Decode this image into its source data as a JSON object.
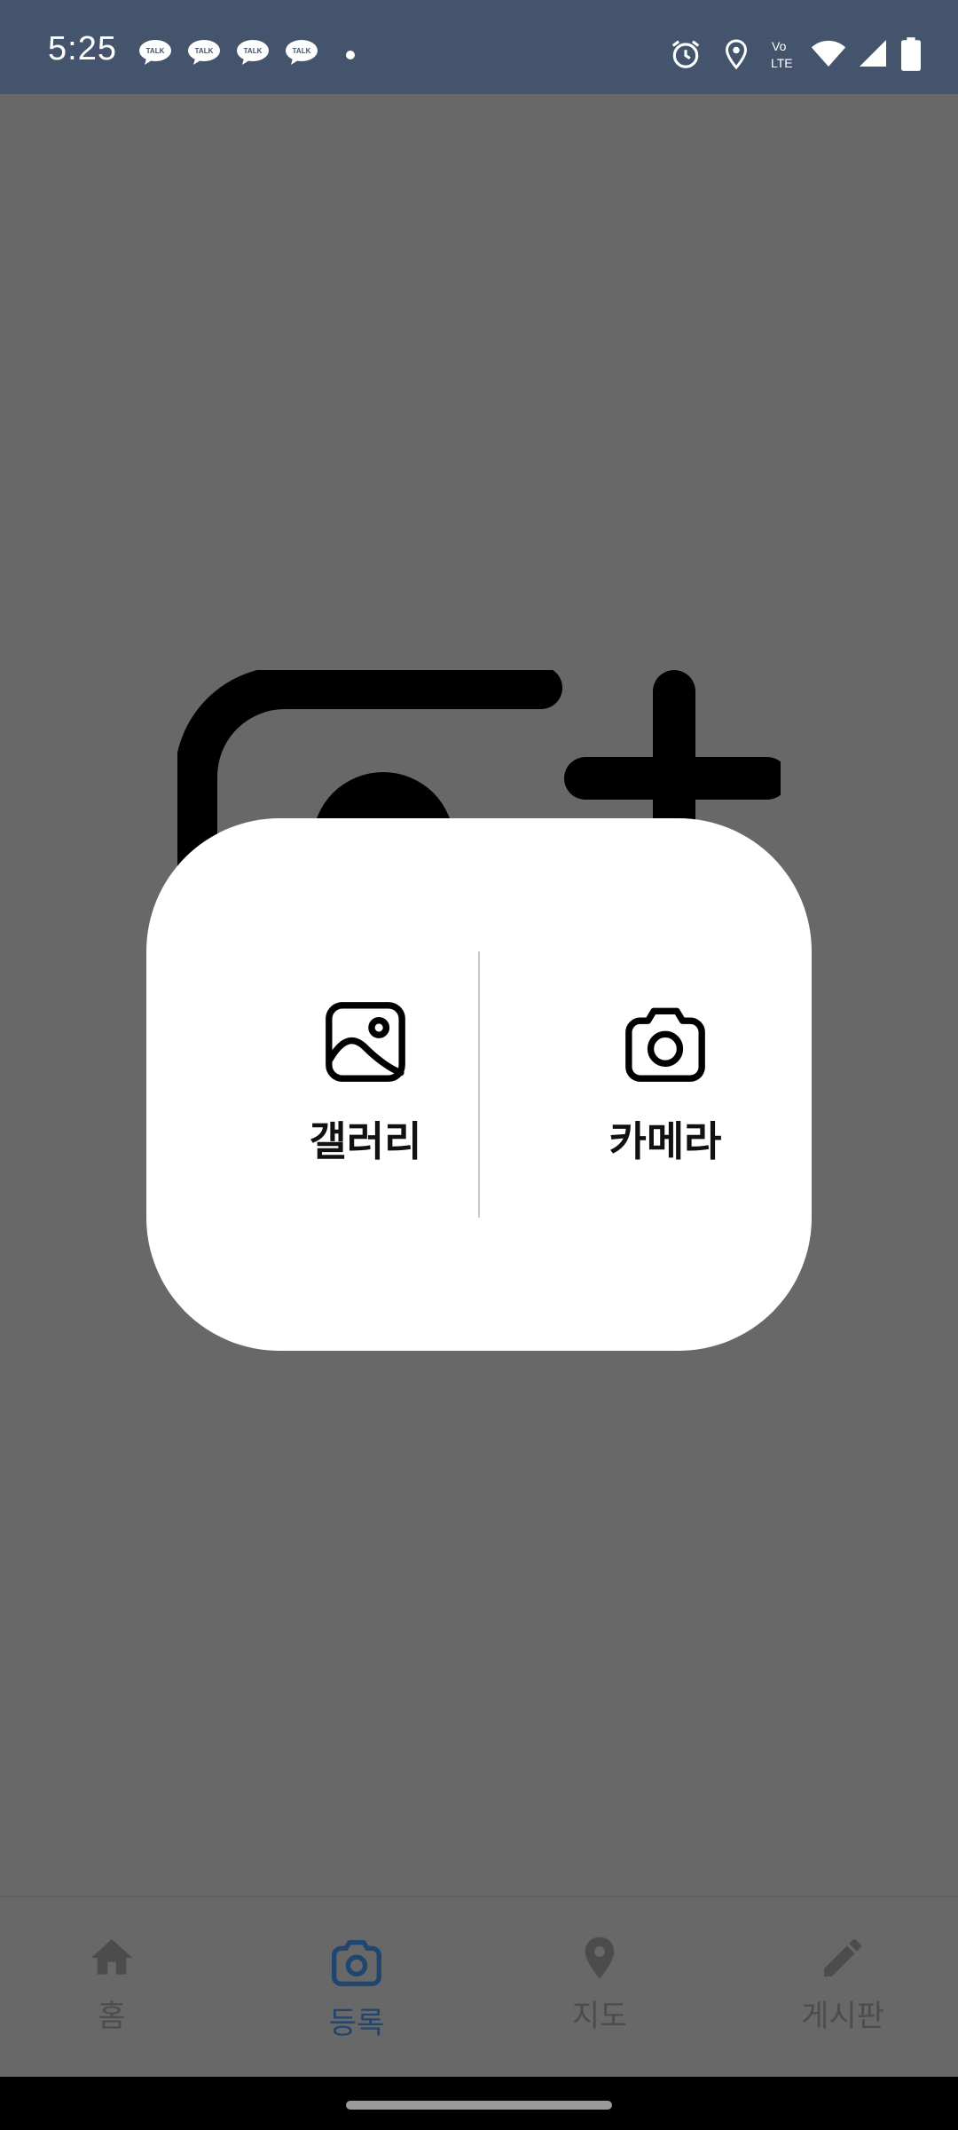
{
  "status_bar": {
    "time": "5:25",
    "notification_icons": [
      "talk-icon",
      "talk-icon",
      "talk-icon",
      "talk-icon"
    ],
    "talk_text": "TALK",
    "status_icons": [
      "alarm-icon",
      "location-icon",
      "volte-icon",
      "wifi-icon",
      "signal-icon",
      "battery-icon"
    ],
    "volte_top": "Vo",
    "volte_bottom": "LTE"
  },
  "dialog": {
    "gallery_label": "갤러리",
    "camera_label": "카메라"
  },
  "bottom_nav": {
    "items": [
      {
        "label": "홈",
        "icon": "home-icon"
      },
      {
        "label": "등록",
        "icon": "camera-icon",
        "active": true
      },
      {
        "label": "지도",
        "icon": "map-pin-icon"
      },
      {
        "label": "게시판",
        "icon": "pencil-icon"
      }
    ]
  },
  "colors": {
    "status_bar": "#44546c",
    "scrim_background": "#686868",
    "active_nav": "#20456e",
    "dialog_background": "#ffffff"
  }
}
